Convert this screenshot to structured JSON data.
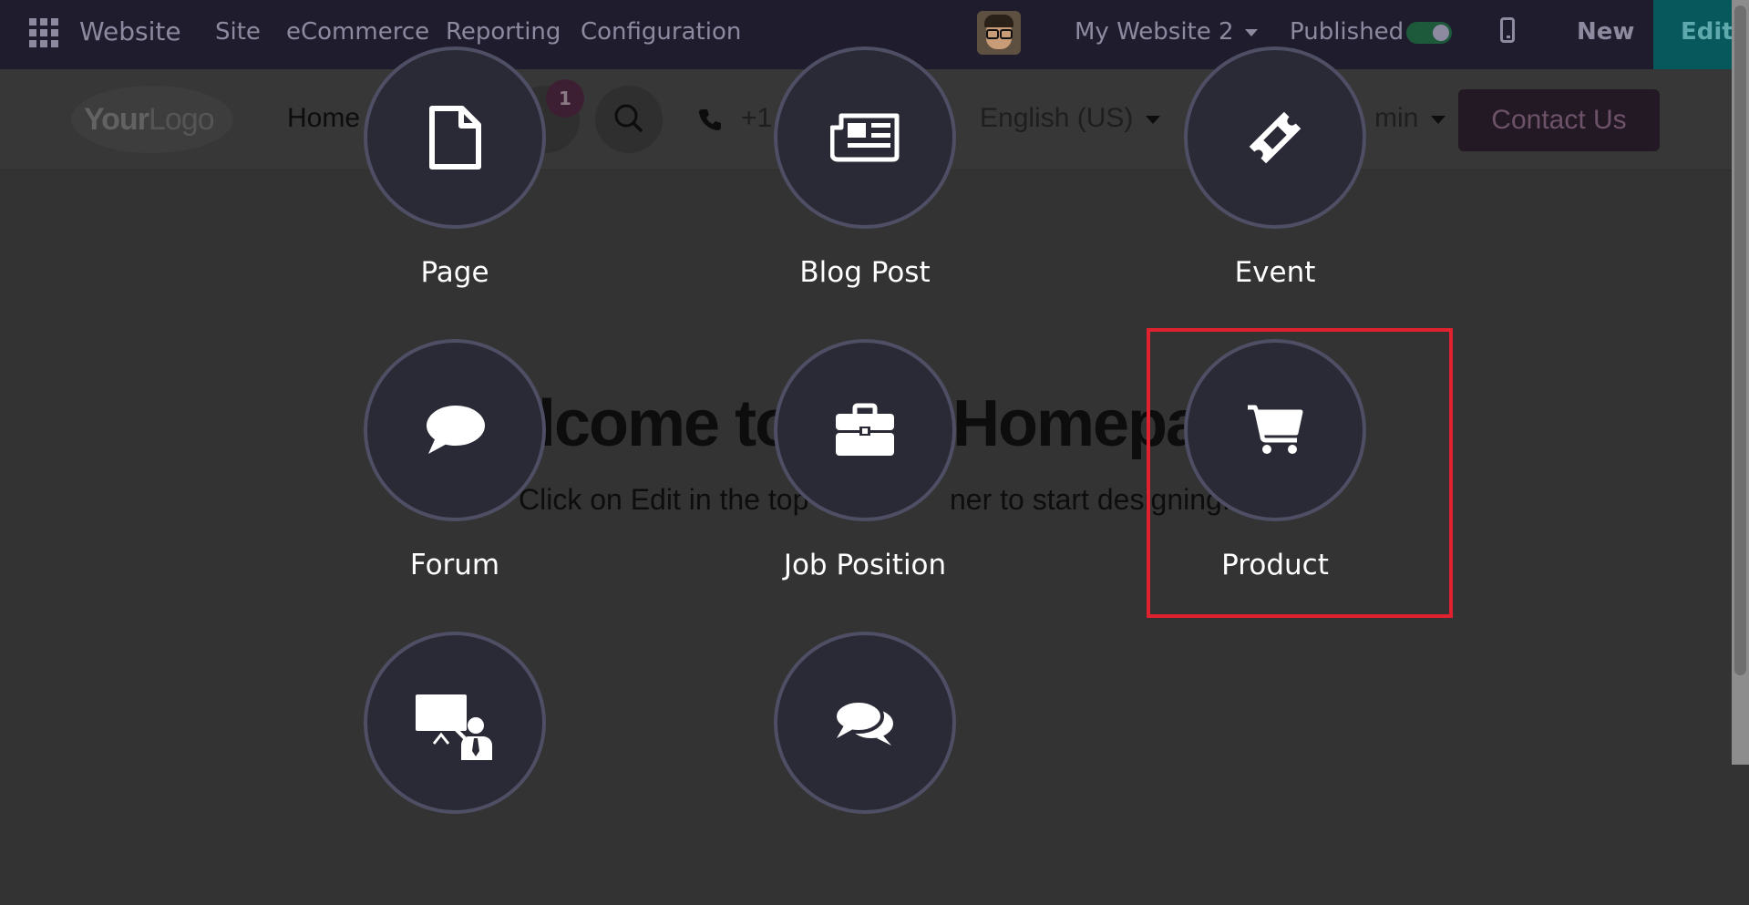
{
  "topbar": {
    "app_name": "Website",
    "menu": [
      "Site",
      "eCommerce",
      "Reporting",
      "Configuration"
    ],
    "website_selector": "My Website 2",
    "published_label": "Published",
    "published": true,
    "new_label": "New",
    "edit_label": "Edit"
  },
  "site_header": {
    "logo_text_bold": "Your",
    "logo_text": "Logo",
    "home_label": "Home",
    "cart_count": "1",
    "phone_partial": "+1",
    "language": "English (US)",
    "user_partial": "min",
    "contact_button": "Contact Us"
  },
  "page": {
    "title_partial": "lcome to",
    "title_partial_2": "Homepa",
    "subtitle_prefix": "Click on ",
    "subtitle_bold": "Edit",
    "subtitle_rest_a": " in the top",
    "subtitle_rest_b": "ner to start designing."
  },
  "new_content": {
    "items": [
      {
        "label": "Page",
        "icon": "file-icon"
      },
      {
        "label": "Blog Post",
        "icon": "newspaper-icon"
      },
      {
        "label": "Event",
        "icon": "ticket-icon"
      },
      {
        "label": "Forum",
        "icon": "comment-icon"
      },
      {
        "label": "Job Position",
        "icon": "briefcase-icon"
      },
      {
        "label": "Product",
        "icon": "shopping-cart-icon"
      },
      {
        "label": "",
        "icon": "presentation-icon"
      },
      {
        "label": "",
        "icon": "comments-icon"
      }
    ],
    "highlighted": "Product"
  },
  "colors": {
    "overlay_bg": "#333333",
    "circle_bg": "#2a2a37",
    "circle_border": "#4e4e64",
    "highlight": "#e0212f",
    "topbar": "#1f1d2d"
  }
}
